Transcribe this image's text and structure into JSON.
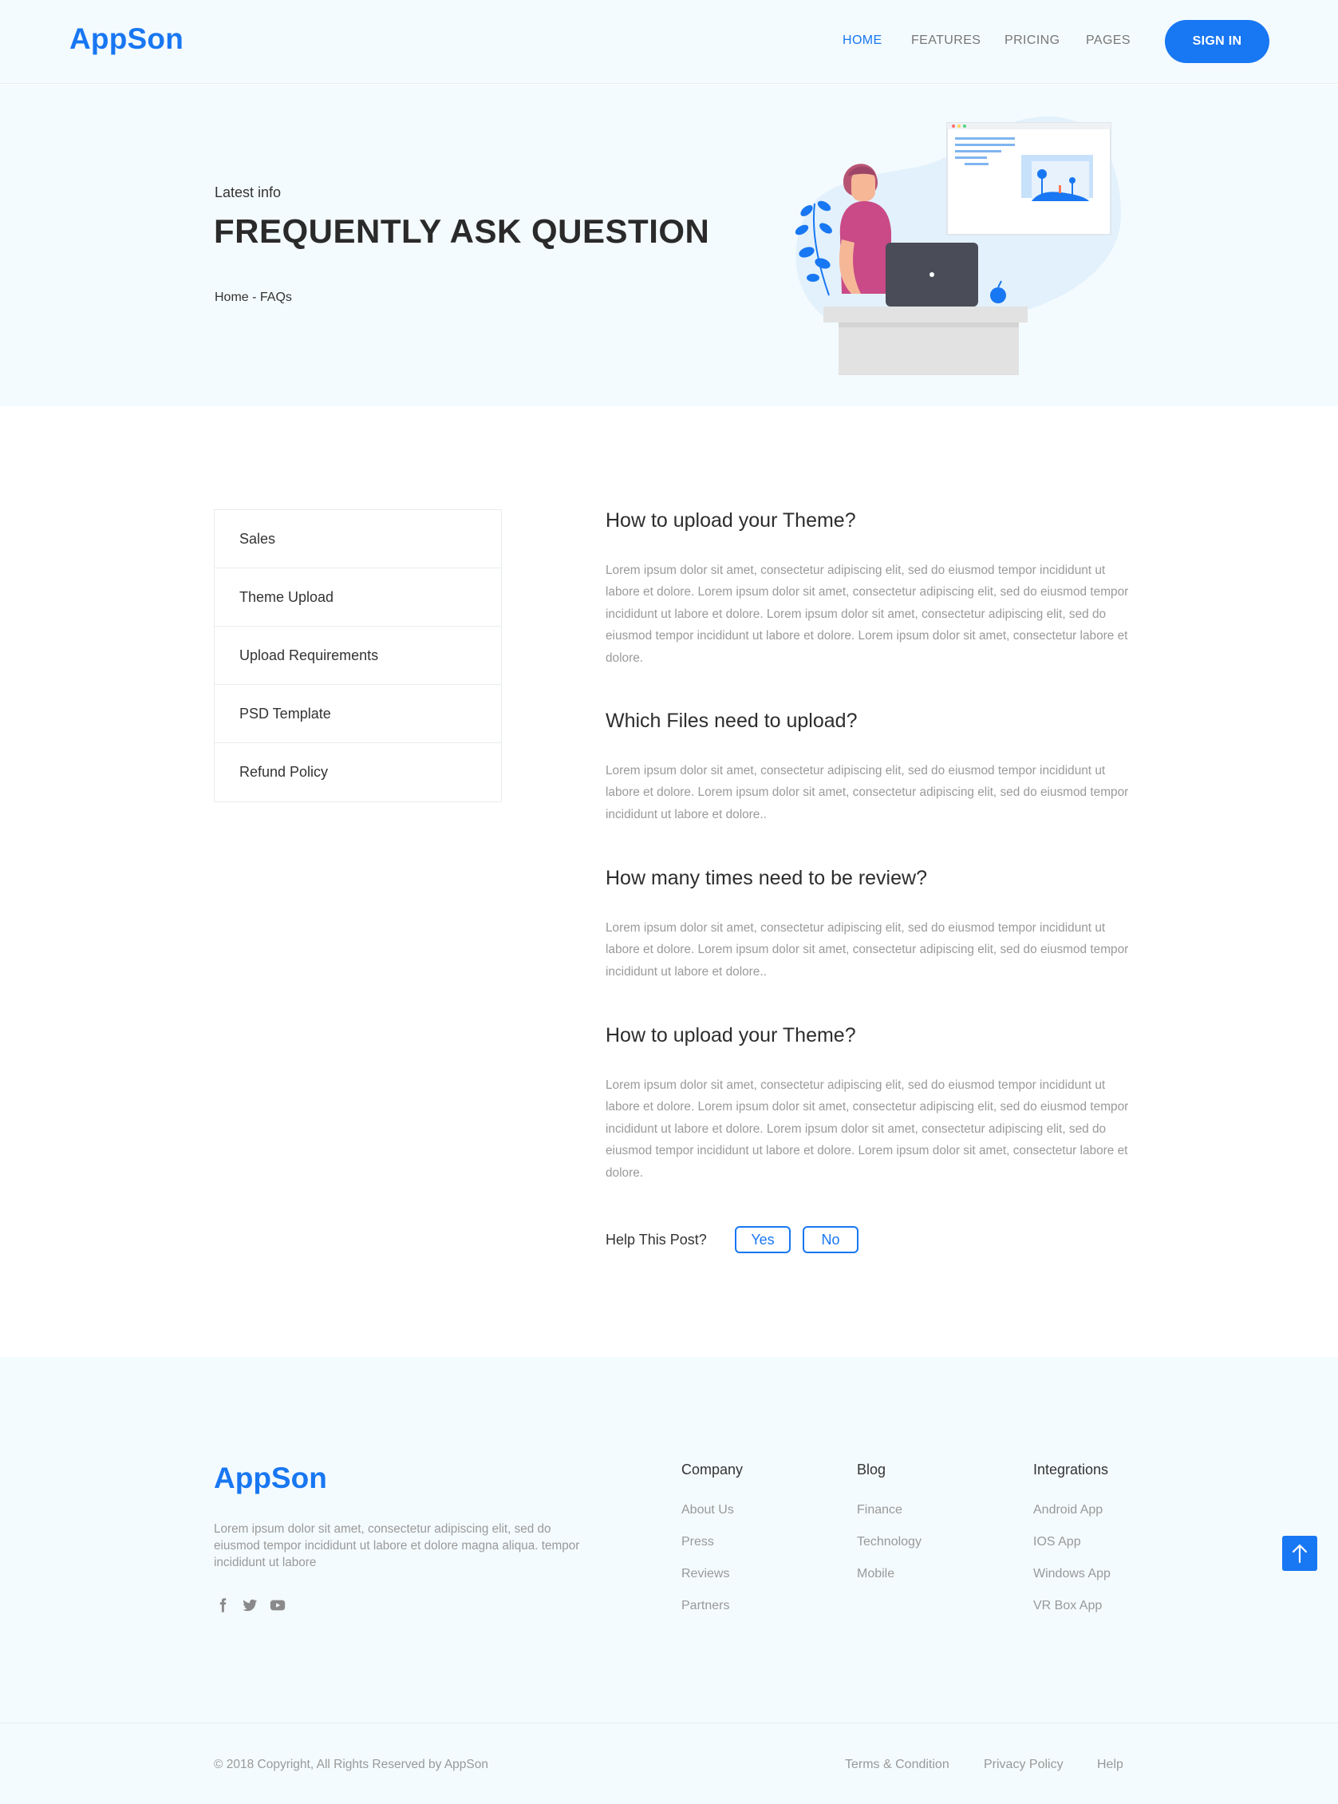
{
  "header": {
    "logo": "AppSon",
    "nav": [
      "HOME",
      "FEATURES",
      "PRICING",
      "PAGES"
    ],
    "sign_in": "SIGN IN"
  },
  "hero": {
    "eyebrow": "Latest info",
    "title": "FREQUENTLY ASK QUESTION",
    "breadcrumb": "Home - FAQs"
  },
  "sidebar": {
    "items": [
      "Sales",
      "Theme Upload",
      "Upload Requirements",
      "PSD Template",
      "Refund Policy"
    ]
  },
  "faqs": [
    {
      "question": "How to upload your Theme?",
      "answer": "Lorem ipsum dolor sit amet, consectetur adipiscing elit, sed do eiusmod tempor incididunt ut labore et dolore. Lorem ipsum dolor sit amet, consectetur adipiscing elit, sed do eiusmod tempor incididunt ut labore et dolore. Lorem ipsum dolor sit amet, consectetur adipiscing elit, sed do eiusmod tempor incididunt ut labore et dolore. Lorem ipsum dolor sit amet, consectetur labore et dolore."
    },
    {
      "question": "Which Files need to upload?",
      "answer": "Lorem ipsum dolor sit amet, consectetur adipiscing elit, sed do eiusmod tempor incididunt ut labore et dolore. Lorem ipsum dolor sit amet, consectetur adipiscing elit, sed do eiusmod tempor incididunt ut labore et dolore.."
    },
    {
      "question": "How many times need to be review?",
      "answer": "Lorem ipsum dolor sit amet, consectetur adipiscing elit, sed do eiusmod tempor incididunt ut labore et dolore. Lorem ipsum dolor sit amet, consectetur adipiscing elit, sed do eiusmod tempor incididunt ut labore et dolore.."
    },
    {
      "question": "How to upload your Theme?",
      "answer": "Lorem ipsum dolor sit amet, consectetur adipiscing elit, sed do eiusmod tempor incididunt ut labore et dolore. Lorem ipsum dolor sit amet, consectetur adipiscing elit, sed do eiusmod tempor incididunt ut labore et dolore. Lorem ipsum dolor sit amet, consectetur adipiscing elit, sed do eiusmod tempor incididunt ut labore et dolore. Lorem ipsum dolor sit amet, consectetur labore et dolore."
    }
  ],
  "help": {
    "label": "Help This Post?",
    "yes": "Yes",
    "no": "No"
  },
  "footer": {
    "logo": "AppSon",
    "description": "Lorem ipsum dolor sit amet, consectetur adipiscing elit, sed do eiusmod tempor incididunt ut labore et dolore magna aliqua. tempor incididunt ut labore",
    "social": [
      "facebook-icon",
      "twitter-icon",
      "youtube-icon"
    ],
    "columns": [
      {
        "title": "Company",
        "links": [
          "About Us",
          "Press",
          "Reviews",
          "Partners"
        ]
      },
      {
        "title": "Blog",
        "links": [
          "Finance",
          "Technology",
          "Mobile"
        ]
      },
      {
        "title": "Integrations",
        "links": [
          "Android App",
          "IOS App",
          "Windows App",
          "VR Box App"
        ]
      }
    ],
    "copyright": "© 2018 Copyright, All Rights Reserved by AppSon",
    "bottom_links": [
      "Terms & Condition",
      "Privacy Policy",
      "Help"
    ]
  },
  "colors": {
    "accent": "#1877f2",
    "hero_bg": "#f4fbfe",
    "muted_text": "#999999"
  }
}
